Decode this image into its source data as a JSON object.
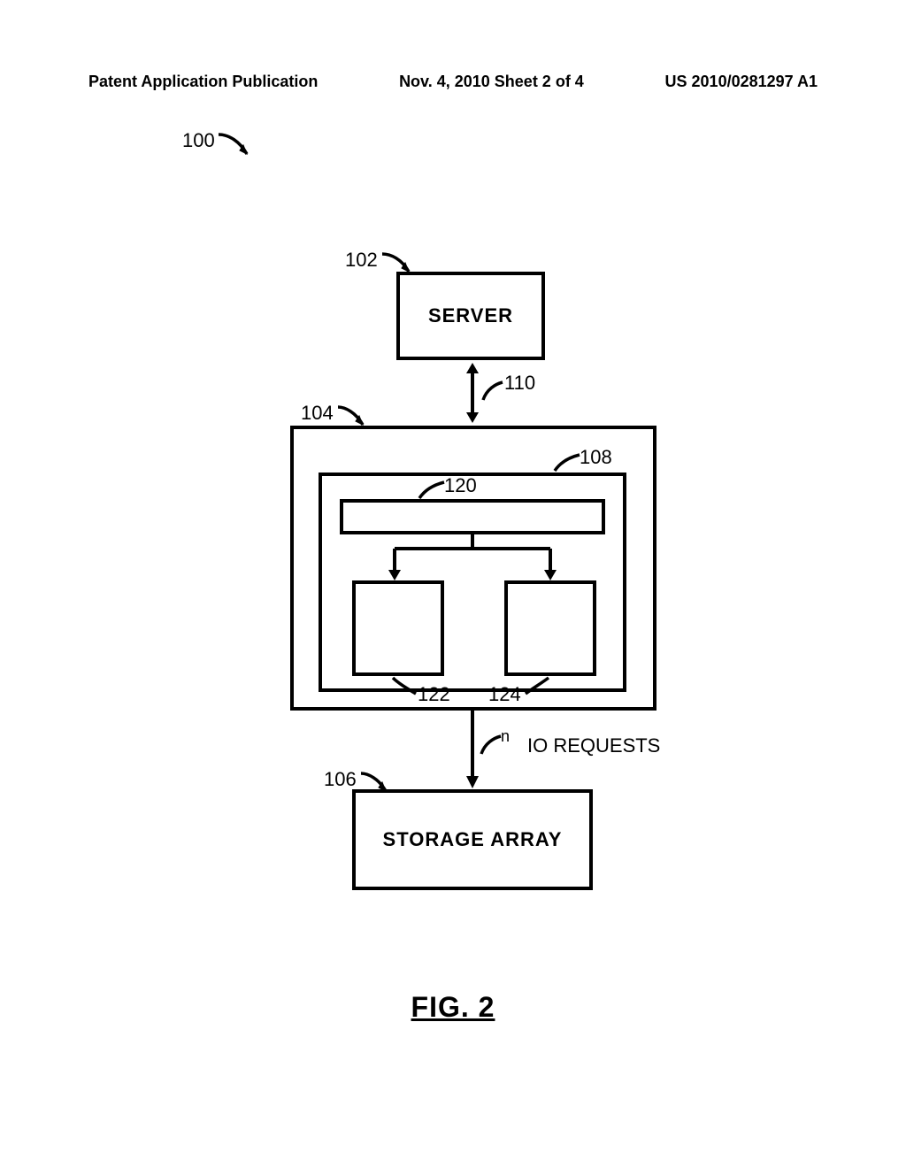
{
  "header": {
    "left": "Patent Application Publication",
    "mid": "Nov. 4, 2010  Sheet 2 of 4",
    "right": "US 2010/0281297 A1"
  },
  "refs": {
    "r100": "100",
    "r102": "102",
    "r104": "104",
    "r106": "106",
    "r108": "108",
    "r110": "110",
    "r120": "120",
    "r122": "122",
    "r124": "124",
    "r_n": "n",
    "io_requests": "IO REQUESTS"
  },
  "boxes": {
    "server": "SERVER",
    "storage_array": "STORAGE ARRAY"
  },
  "figure_caption": "FIG. 2",
  "chart_data": {
    "type": "diagram",
    "title": "FIG. 2",
    "reference_numeral": "100",
    "nodes": [
      {
        "id": "102",
        "label": "SERVER",
        "type": "box"
      },
      {
        "id": "104",
        "label": "",
        "type": "container_box"
      },
      {
        "id": "108",
        "label": "",
        "type": "inner_container_box",
        "parent": "104"
      },
      {
        "id": "120",
        "label": "",
        "type": "slim_box",
        "parent": "108"
      },
      {
        "id": "122",
        "label": "",
        "type": "box",
        "parent": "108"
      },
      {
        "id": "124",
        "label": "",
        "type": "box",
        "parent": "108"
      },
      {
        "id": "106",
        "label": "STORAGE ARRAY",
        "type": "box"
      }
    ],
    "edges": [
      {
        "from": "102",
        "to": "104",
        "label_id": "110",
        "direction": "bidirectional"
      },
      {
        "from": "120",
        "to": "122",
        "direction": "down"
      },
      {
        "from": "120",
        "to": "124",
        "direction": "down"
      },
      {
        "from": "104",
        "to": "106",
        "label_id": "n",
        "annotation": "IO REQUESTS",
        "direction": "down"
      }
    ]
  }
}
